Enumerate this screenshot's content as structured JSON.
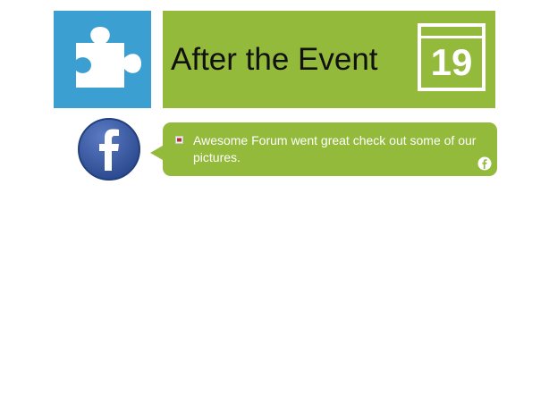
{
  "header": {
    "title": "After the Event",
    "date_number": "19"
  },
  "icons": {
    "tile": "puzzle-piece-icon",
    "avatar": "facebook-icon",
    "post_type": "link-icon",
    "source": "facebook-small-icon"
  },
  "post": {
    "text": "Awesome Forum went great check out some of our pictures."
  },
  "colors": {
    "tile_blue": "#3b9fd1",
    "accent_green": "#93ba3b",
    "facebook_blue": "#3b5998"
  }
}
